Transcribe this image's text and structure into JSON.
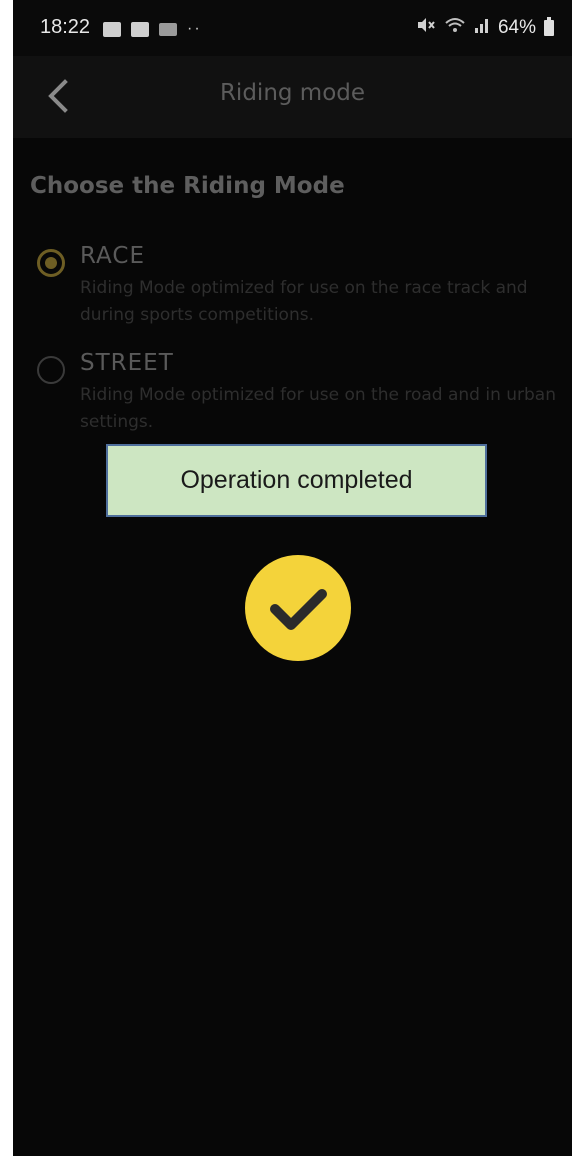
{
  "status_bar": {
    "time": "18:22",
    "left_icons": [
      "gallery-icon",
      "news-icon",
      "tech-icon"
    ],
    "more": "··",
    "battery": "64%"
  },
  "header": {
    "title": "Riding mode"
  },
  "main": {
    "section_title": "Choose the Riding Mode",
    "options": [
      {
        "label": "RACE",
        "description": "Riding Mode optimized for use on the race track and during sports competitions.",
        "selected": true
      },
      {
        "label": "STREET",
        "description": "Riding Mode optimized for use on the road and in urban settings.",
        "selected": false
      }
    ]
  },
  "toast": {
    "message": "Operation completed"
  },
  "colors": {
    "accent": "#f4d33a",
    "toast_bg": "#cde6c2",
    "toast_border": "#4f6f9c"
  }
}
